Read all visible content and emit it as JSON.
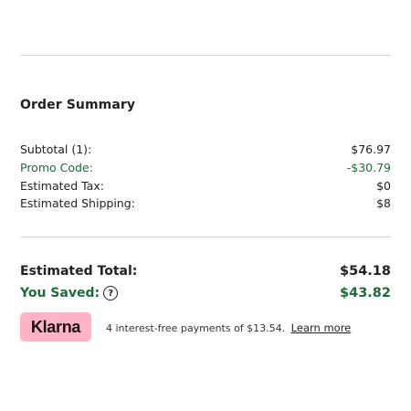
{
  "order_summary": {
    "title": "Order Summary",
    "lines": [
      {
        "label": "Subtotal (1):",
        "value": "$76.97"
      },
      {
        "label": "Promo Code:",
        "value": "-$30.79"
      },
      {
        "label": "Estimated Tax:",
        "value": "$0"
      },
      {
        "label": "Estimated Shipping:",
        "value": "$8"
      }
    ],
    "estimated_total_label": "Estimated Total:",
    "estimated_total_value": "$54.18",
    "you_saved_label": "You Saved:",
    "you_saved_value": "$43.82",
    "help_icon_glyph": "?"
  },
  "klarna": {
    "badge_text": "Klarna",
    "message": "4 interest-free payments of $13.54.",
    "learn_more_label": "Learn more"
  },
  "colors": {
    "accent_green": "#1f6b3d",
    "klarna_pink": "#ffb3c7",
    "divider": "#d9d9d9"
  }
}
